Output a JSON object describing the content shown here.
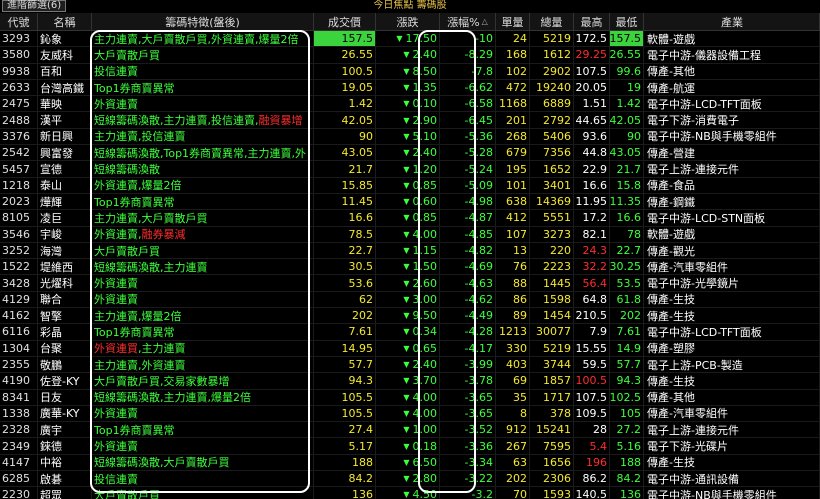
{
  "tab_label": "進階篩選(6)",
  "title": "今日焦點 籌碼股",
  "headers": [
    "代號",
    "名稱",
    "籌碼特徵(盤後)",
    "成交價",
    "漲跌",
    "漲幅%",
    "單量",
    "總量",
    "最高",
    "最低",
    "產業"
  ],
  "sort_indicator": "△",
  "colors": {
    "up": "#ff2c2c",
    "down": "#3cff3c",
    "flat": "#ffffff",
    "text_yellow": "#f5e92e",
    "highlight": "#3cd43c"
  },
  "rows": [
    {
      "code": "3293",
      "name": "鈊象",
      "feat": [
        {
          "t": "主力連賣,大戶賣散戶買,外資連賣,爆量2倍",
          "c": "g"
        }
      ],
      "price": "157.5",
      "price_hl": true,
      "chg": "17.50",
      "pct": "-10",
      "unit": "24",
      "total": "5219",
      "high": "172.5",
      "high_c": "w",
      "low": "157.5",
      "low_hl": true,
      "industry": "軟體-遊戲"
    },
    {
      "code": "3580",
      "name": "友威科",
      "feat": [
        {
          "t": "大戶賣散戶買",
          "c": "g"
        }
      ],
      "price": "26.55",
      "chg": "2.40",
      "pct": "-8.29",
      "unit": "168",
      "total": "1612",
      "high": "29.25",
      "high_c": "r",
      "low": "26.55",
      "industry": "電子中游-儀器設備工程"
    },
    {
      "code": "9938",
      "name": "百和",
      "feat": [
        {
          "t": "投信連賣",
          "c": "g"
        }
      ],
      "price": "100.5",
      "chg": "8.50",
      "pct": "-7.8",
      "unit": "102",
      "total": "2902",
      "high": "107.5",
      "high_c": "w",
      "low": "99.6",
      "industry": "傳產-其他"
    },
    {
      "code": "2633",
      "name": "台灣高鐵",
      "feat": [
        {
          "t": "Top1券商賣異常",
          "c": "g"
        }
      ],
      "price": "19.05",
      "chg": "1.35",
      "pct": "-6.62",
      "unit": "472",
      "total": "19240",
      "high": "20.05",
      "high_c": "w",
      "low": "19",
      "industry": "傳產-航運"
    },
    {
      "code": "2475",
      "name": "華映",
      "feat": [
        {
          "t": "外資連賣",
          "c": "g"
        }
      ],
      "price": "1.42",
      "chg": "0.10",
      "pct": "-6.58",
      "unit": "1168",
      "total": "6889",
      "high": "1.51",
      "high_c": "w",
      "low": "1.42",
      "industry": "電子中游-LCD-TFT面板"
    },
    {
      "code": "2488",
      "name": "漢平",
      "feat": [
        {
          "t": "短線籌碼渙散,主力連賣,投信連賣,",
          "c": "g"
        },
        {
          "t": "融資暴增",
          "c": "r"
        }
      ],
      "price": "42.05",
      "chg": "2.90",
      "pct": "-6.45",
      "unit": "201",
      "total": "2792",
      "high": "44.65",
      "high_c": "w",
      "low": "42.05",
      "industry": "電子下游-消費電子"
    },
    {
      "code": "3376",
      "name": "新日興",
      "feat": [
        {
          "t": "主力連賣,投信連賣",
          "c": "g"
        }
      ],
      "price": "90",
      "chg": "5.10",
      "pct": "-5.36",
      "unit": "268",
      "total": "5406",
      "high": "93.6",
      "high_c": "w",
      "low": "90",
      "industry": "電子中游-NB與手機零組件"
    },
    {
      "code": "2542",
      "name": "興富發",
      "feat": [
        {
          "t": "短線籌碼渙散,Top1券商賣異常,主力連賣,外",
          "c": "g"
        }
      ],
      "price": "43.05",
      "chg": "2.40",
      "pct": "-5.28",
      "unit": "679",
      "total": "7356",
      "high": "44.8",
      "high_c": "w",
      "low": "43.05",
      "industry": "傳產-營建"
    },
    {
      "code": "5457",
      "name": "宣德",
      "feat": [
        {
          "t": "短線籌碼渙散",
          "c": "g"
        }
      ],
      "price": "21.7",
      "chg": "1.20",
      "pct": "-5.24",
      "unit": "195",
      "total": "1652",
      "high": "22.9",
      "high_c": "w",
      "low": "21.7",
      "industry": "電子上游-連接元件"
    },
    {
      "code": "1218",
      "name": "泰山",
      "feat": [
        {
          "t": "外資連賣,爆量2倍",
          "c": "g"
        }
      ],
      "price": "15.85",
      "chg": "0.85",
      "pct": "-5.09",
      "unit": "101",
      "total": "3401",
      "high": "16.6",
      "high_c": "w",
      "low": "15.8",
      "industry": "傳產-食品"
    },
    {
      "code": "2023",
      "name": "燁輝",
      "feat": [
        {
          "t": "Top1券商賣異常",
          "c": "g"
        }
      ],
      "price": "11.45",
      "chg": "0.60",
      "pct": "-4.98",
      "unit": "638",
      "total": "14369",
      "high": "11.95",
      "high_c": "w",
      "low": "11.35",
      "industry": "傳產-鋼鐵"
    },
    {
      "code": "8105",
      "name": "凌巨",
      "feat": [
        {
          "t": "主力連賣,大戶賣散戶買",
          "c": "g"
        }
      ],
      "price": "16.6",
      "chg": "0.85",
      "pct": "-4.87",
      "unit": "412",
      "total": "5551",
      "high": "17.2",
      "high_c": "w",
      "low": "16.6",
      "industry": "電子中游-LCD-STN面板"
    },
    {
      "code": "3546",
      "name": "宇峻",
      "feat": [
        {
          "t": "外資連賣,",
          "c": "g"
        },
        {
          "t": "融券暴減",
          "c": "r"
        }
      ],
      "price": "78.5",
      "chg": "4.00",
      "pct": "-4.85",
      "unit": "107",
      "total": "3273",
      "high": "82.1",
      "high_c": "w",
      "low": "78",
      "industry": "軟體-遊戲"
    },
    {
      "code": "3252",
      "name": "海灣",
      "feat": [
        {
          "t": "大戶賣散戶買",
          "c": "g"
        }
      ],
      "price": "22.7",
      "chg": "1.15",
      "pct": "-4.82",
      "unit": "13",
      "total": "220",
      "high": "24.3",
      "high_c": "r",
      "low": "22.7",
      "industry": "傳產-觀光"
    },
    {
      "code": "1522",
      "name": "堤維西",
      "feat": [
        {
          "t": "短線籌碼渙散,主力連賣",
          "c": "g"
        }
      ],
      "price": "30.5",
      "chg": "1.50",
      "pct": "-4.69",
      "unit": "76",
      "total": "2223",
      "high": "32.2",
      "high_c": "r",
      "low": "30.25",
      "industry": "傳產-汽車零組件"
    },
    {
      "code": "3428",
      "name": "光燿科",
      "feat": [
        {
          "t": "外資連賣",
          "c": "g"
        }
      ],
      "price": "53.6",
      "chg": "2.60",
      "pct": "-4.63",
      "unit": "88",
      "total": "1445",
      "high": "56.4",
      "high_c": "r",
      "low": "53.5",
      "industry": "電子中游-光學鏡片"
    },
    {
      "code": "4129",
      "name": "聯合",
      "feat": [
        {
          "t": "外資連賣",
          "c": "g"
        }
      ],
      "price": "62",
      "chg": "3.00",
      "pct": "-4.62",
      "unit": "86",
      "total": "1598",
      "high": "64.8",
      "high_c": "w",
      "low": "61.8",
      "industry": "傳產-生技"
    },
    {
      "code": "4162",
      "name": "智擎",
      "feat": [
        {
          "t": "主力連賣,爆量2倍",
          "c": "g"
        }
      ],
      "price": "202",
      "chg": "9.50",
      "pct": "-4.49",
      "unit": "89",
      "total": "1454",
      "high": "210.5",
      "high_c": "w",
      "low": "202",
      "industry": "傳產-生技"
    },
    {
      "code": "6116",
      "name": "彩晶",
      "feat": [
        {
          "t": "Top1券商賣異常",
          "c": "g"
        }
      ],
      "price": "7.61",
      "chg": "0.34",
      "pct": "-4.28",
      "unit": "1213",
      "total": "30077",
      "high": "7.9",
      "high_c": "w",
      "low": "7.61",
      "industry": "電子中游-LCD-TFT面板"
    },
    {
      "code": "1304",
      "name": "台聚",
      "feat": [
        {
          "t": "外資連買",
          "c": "r"
        },
        {
          "t": ",主力連賣",
          "c": "g"
        }
      ],
      "price": "14.95",
      "chg": "0.65",
      "pct": "-4.17",
      "unit": "330",
      "total": "5219",
      "high": "15.55",
      "high_c": "w",
      "low": "14.9",
      "industry": "傳產-塑膠"
    },
    {
      "code": "2355",
      "name": "敬鵬",
      "feat": [
        {
          "t": "主力連賣,外資連賣",
          "c": "g"
        }
      ],
      "price": "57.7",
      "chg": "2.40",
      "pct": "-3.99",
      "unit": "403",
      "total": "3744",
      "high": "59.5",
      "high_c": "w",
      "low": "57.7",
      "industry": "電子上游-PCB-製造"
    },
    {
      "code": "4190",
      "name": "佐登-KY",
      "feat": [
        {
          "t": "大戶賣散戶買,交易家數暴增",
          "c": "g"
        }
      ],
      "price": "94.3",
      "chg": "3.70",
      "pct": "-3.78",
      "unit": "69",
      "total": "1857",
      "high": "100.5",
      "high_c": "r",
      "low": "94.3",
      "industry": "傳產-生技"
    },
    {
      "code": "8341",
      "name": "日友",
      "feat": [
        {
          "t": "短線籌碼渙散,主力連賣,爆量2倍",
          "c": "g"
        }
      ],
      "price": "105.5",
      "chg": "4.00",
      "pct": "-3.65",
      "unit": "35",
      "total": "1717",
      "high": "107.5",
      "high_c": "w",
      "low": "102.5",
      "industry": "傳產-其他"
    },
    {
      "code": "1338",
      "name": "廣華-KY",
      "feat": [
        {
          "t": "外資連賣",
          "c": "g"
        }
      ],
      "price": "105.5",
      "chg": "4.00",
      "pct": "-3.65",
      "unit": "8",
      "total": "378",
      "high": "109.5",
      "high_c": "w",
      "low": "105",
      "industry": "傳產-汽車零組件"
    },
    {
      "code": "2328",
      "name": "廣宇",
      "feat": [
        {
          "t": "Top1券商賣異常",
          "c": "g"
        }
      ],
      "price": "27.4",
      "chg": "1.00",
      "pct": "-3.52",
      "unit": "912",
      "total": "15241",
      "high": "28",
      "high_c": "w",
      "low": "27.2",
      "industry": "電子上游-連接元件"
    },
    {
      "code": "2349",
      "name": "錸德",
      "feat": [
        {
          "t": "外資連賣",
          "c": "g"
        }
      ],
      "price": "5.17",
      "chg": "0.18",
      "pct": "-3.36",
      "unit": "267",
      "total": "7595",
      "high": "5.4",
      "high_c": "r",
      "low": "5.16",
      "industry": "電子下游-光碟片"
    },
    {
      "code": "4147",
      "name": "中裕",
      "feat": [
        {
          "t": "短線籌碼渙散,大戶賣散戶買",
          "c": "g"
        }
      ],
      "price": "188",
      "chg": "6.50",
      "pct": "-3.34",
      "unit": "63",
      "total": "1656",
      "high": "196",
      "high_c": "r",
      "low": "188",
      "industry": "傳產-生技"
    },
    {
      "code": "6285",
      "name": "啟碁",
      "feat": [
        {
          "t": "投信連賣",
          "c": "g"
        }
      ],
      "price": "84.2",
      "chg": "2.80",
      "pct": "-3.22",
      "unit": "202",
      "total": "2306",
      "high": "86.2",
      "high_c": "w",
      "low": "84.2",
      "industry": "電子中游-通訊設備"
    },
    {
      "code": "2230",
      "name": "超眾",
      "feat": [
        {
          "t": "大戶賣散戶買",
          "c": "g"
        }
      ],
      "price": "136",
      "chg": "4.50",
      "pct": "-3.2",
      "unit": "70",
      "total": "1593",
      "high": "140.5",
      "high_c": "w",
      "low": "136",
      "industry": "電子中游-NB與手機零組件"
    }
  ]
}
